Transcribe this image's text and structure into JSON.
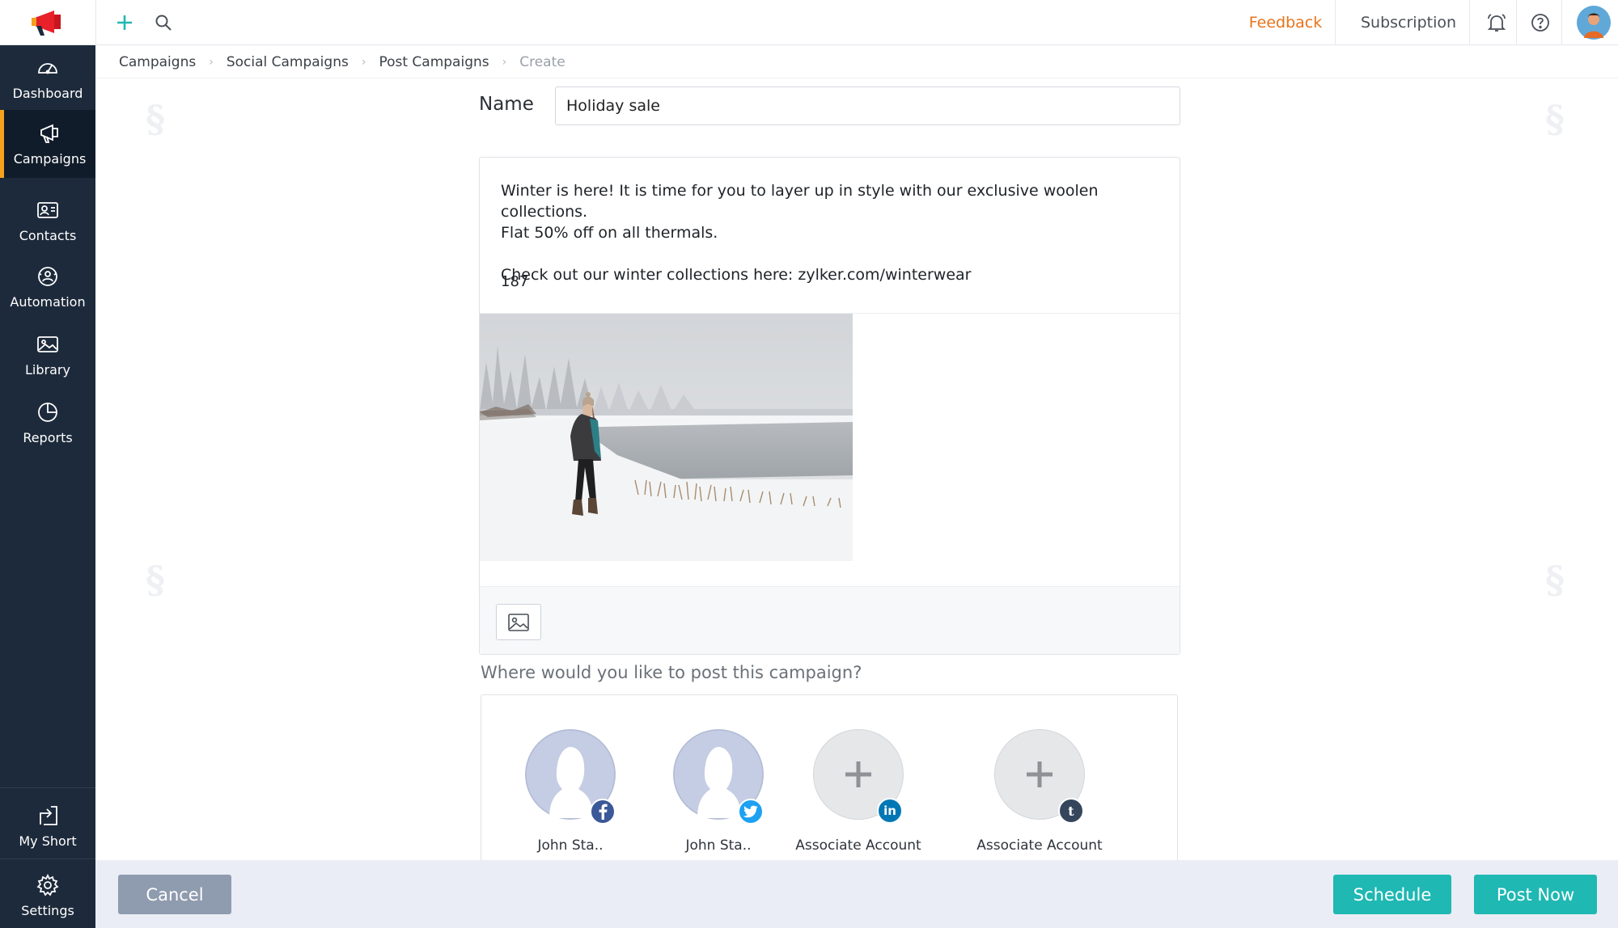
{
  "sidebar": {
    "items": [
      {
        "label": "Dashboard",
        "icon": "gauge-icon"
      },
      {
        "label": "Campaigns",
        "icon": "megaphone-icon",
        "active": true
      },
      {
        "label": "Contacts",
        "icon": "contact-card-icon"
      },
      {
        "label": "Automation",
        "icon": "automation-icon"
      },
      {
        "label": "Library",
        "icon": "image-library-icon"
      },
      {
        "label": "Reports",
        "icon": "pie-chart-icon"
      }
    ],
    "bottom_items": [
      {
        "label": "My Short",
        "icon": "share-arrow-icon"
      },
      {
        "label": "Settings",
        "icon": "gear-icon"
      }
    ]
  },
  "topbar": {
    "feedback": "Feedback",
    "subscription": "Subscription"
  },
  "breadcrumb": [
    "Campaigns",
    "Social Campaigns",
    "Post Campaigns",
    "Create"
  ],
  "form": {
    "name_label": "Name",
    "name_value": "Holiday sale",
    "post_line1": "Winter is here! It is time for you to layer up in style with our exclusive woolen collections.",
    "post_line2": "Flat 50% off on all thermals.",
    "post_line3": "Check out our winter collections here: zylker.com/winterwear",
    "char_count": "187",
    "where_label": "Where would you like to post this campaign?"
  },
  "accounts": [
    {
      "label": "John Sta..",
      "network": "facebook",
      "badge_color": "#3b5998",
      "connected": true
    },
    {
      "label": "John Sta..",
      "network": "twitter",
      "badge_color": "#1da1f2",
      "connected": true
    },
    {
      "label": "Associate Account",
      "network": "linkedin",
      "badge_color": "#0077b5",
      "connected": false
    },
    {
      "label": "Associate Account",
      "network": "tumblr",
      "badge_color": "#35465c",
      "connected": false
    }
  ],
  "actions": {
    "cancel": "Cancel",
    "schedule": "Schedule",
    "post_now": "Post Now"
  },
  "colors": {
    "sidebar_bg": "#1d2a3b",
    "active_accent": "#f7a21c",
    "primary_button": "#1fb8b3",
    "feedback": "#e8731a"
  }
}
